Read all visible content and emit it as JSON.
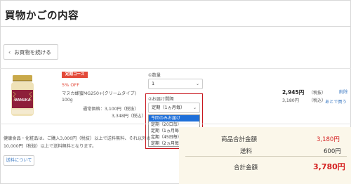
{
  "page": {
    "title": "買物かごの内容"
  },
  "nav": {
    "continue_label": "お買物を続ける"
  },
  "item": {
    "badge": "定期コース",
    "discount": "5% OFF",
    "name": "マヌカ蜂蜜MG250+(クリームタイプ)",
    "amount": "100g",
    "regular_price": "通常価格：3,100円（税抜）",
    "regular_price_tax": "3,348円（税込）",
    "product_image": "manuka-honey-jar",
    "label_text": "MANUKA"
  },
  "quantity": {
    "label": "①数量",
    "value": "1"
  },
  "delivery": {
    "label": "②お届け間隔",
    "selected": "定期（1ヵ月毎）",
    "options": [
      {
        "text": "今回のみお届け",
        "selected": true
      },
      {
        "text": "定期（20日毎）",
        "selected": false
      },
      {
        "text": "定期（1ヵ月毎）",
        "selected": false
      },
      {
        "text": "定期（45日毎）",
        "selected": false
      },
      {
        "text": "定期（2ヵ月毎）",
        "selected": false
      }
    ]
  },
  "line_total": {
    "price": "2,945円",
    "price_tax": "（税抜）",
    "tax_incl": "3,180円",
    "tax_incl_label": "（税込）",
    "delete_label": "削除",
    "later_label": "あとで買う"
  },
  "note": {
    "line1": "健康食品・化粧品は、ご購入3,000円（税抜）以上で送料無料、それ以外の",
    "line2": "10,000円（税抜）以上で送料無料となります。",
    "shipping_button": "送料について"
  },
  "summary": {
    "subtotal_label": "商品合計金額",
    "subtotal_value": "3,180円",
    "shipping_label": "送料",
    "shipping_value": "600円",
    "total_label": "合計金額",
    "total_value": "3,780円"
  },
  "colors": {
    "accent_red": "#d42020",
    "badge_red": "#e34a3a",
    "highlight_box": "#c8161d",
    "selected_option": "#1e6fd9",
    "summary_bg": "#fbf7ea",
    "link_blue": "#3a78c2"
  }
}
